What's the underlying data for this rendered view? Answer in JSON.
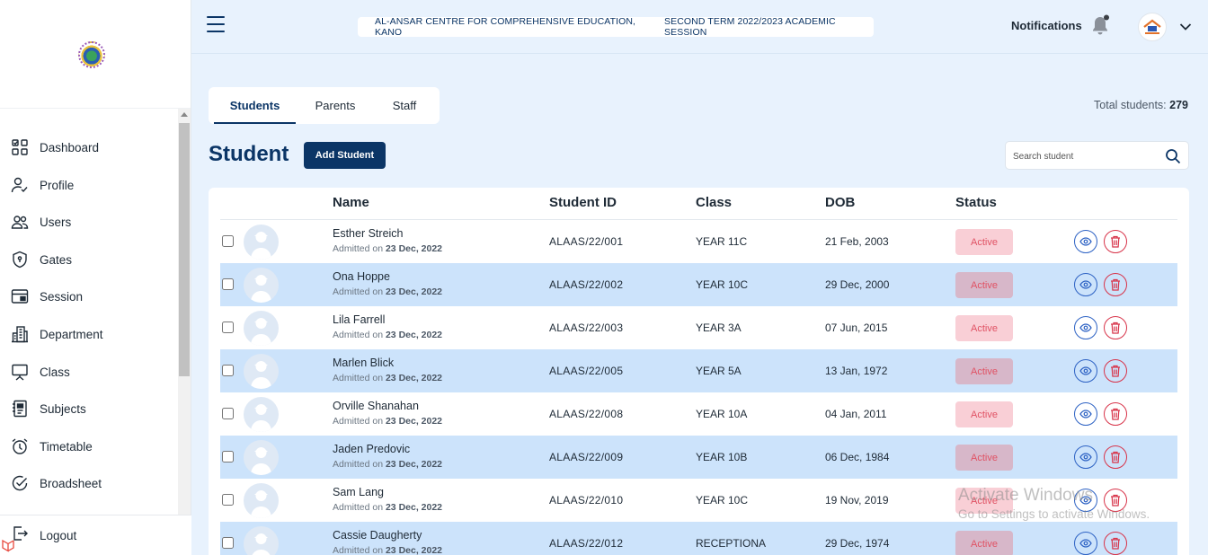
{
  "sidebar": {
    "items": [
      {
        "label": "Dashboard",
        "icon": "dashboard-icon"
      },
      {
        "label": "Profile",
        "icon": "profile-icon"
      },
      {
        "label": "Users",
        "icon": "users-icon"
      },
      {
        "label": "Gates",
        "icon": "shield-icon"
      },
      {
        "label": "Session",
        "icon": "session-icon"
      },
      {
        "label": "Department",
        "icon": "building-icon"
      },
      {
        "label": "Class",
        "icon": "whiteboard-icon"
      },
      {
        "label": "Subjects",
        "icon": "book-icon"
      },
      {
        "label": "Timetable",
        "icon": "alarm-clock-icon"
      },
      {
        "label": "Broadsheet",
        "icon": "badge-check-icon"
      }
    ],
    "logout_label": "Logout"
  },
  "header": {
    "school_name": "AL-ANSAR CENTRE FOR COMPREHENSIVE EDUCATION, KANO",
    "session": "SECOND TERM 2022/2023 ACADEMIC SESSION",
    "notifications_label": "Notifications"
  },
  "tabs": [
    {
      "label": "Students",
      "active": true
    },
    {
      "label": "Parents",
      "active": false
    },
    {
      "label": "Staff",
      "active": false
    }
  ],
  "total": {
    "label": "Total students:",
    "value": "279"
  },
  "page_title": "Student",
  "add_button_label": "Add Student",
  "search": {
    "placeholder": "Search student"
  },
  "table": {
    "columns": [
      "Name",
      "Student ID",
      "Class",
      "DOB",
      "Status"
    ],
    "admitted_prefix": "Admitted on",
    "rows": [
      {
        "name": "Esther Streich",
        "admitted": "23 Dec, 2022",
        "student_id": "ALAAS/22/001",
        "class": "YEAR 11C",
        "dob": "21 Feb, 2003",
        "status": "Active"
      },
      {
        "name": "Ona Hoppe",
        "admitted": "23 Dec, 2022",
        "student_id": "ALAAS/22/002",
        "class": "YEAR 10C",
        "dob": "29 Dec, 2000",
        "status": "Active"
      },
      {
        "name": "Lila Farrell",
        "admitted": "23 Dec, 2022",
        "student_id": "ALAAS/22/003",
        "class": "YEAR 3A",
        "dob": "07 Jun, 2015",
        "status": "Active"
      },
      {
        "name": "Marlen Blick",
        "admitted": "23 Dec, 2022",
        "student_id": "ALAAS/22/005",
        "class": "YEAR 5A",
        "dob": "13 Jan, 1972",
        "status": "Active"
      },
      {
        "name": "Orville Shanahan",
        "admitted": "23 Dec, 2022",
        "student_id": "ALAAS/22/008",
        "class": "YEAR 10A",
        "dob": "04 Jan, 2011",
        "status": "Active"
      },
      {
        "name": "Jaden Predovic",
        "admitted": "23 Dec, 2022",
        "student_id": "ALAAS/22/009",
        "class": "YEAR 10B",
        "dob": "06 Dec, 1984",
        "status": "Active"
      },
      {
        "name": "Sam Lang",
        "admitted": "23 Dec, 2022",
        "student_id": "ALAAS/22/010",
        "class": "YEAR 10C",
        "dob": "19 Nov, 2019",
        "status": "Active"
      },
      {
        "name": "Cassie Daugherty",
        "admitted": "23 Dec, 2022",
        "student_id": "ALAAS/22/012",
        "class": "RECEPTIONA",
        "dob": "29 Dec, 1974",
        "status": "Active"
      }
    ]
  },
  "watermark": {
    "line1": "Activate Windows",
    "line2": "Go to Settings to activate Windows."
  },
  "colors": {
    "primary": "#0b3566",
    "page_bg": "#e8f2fd",
    "row_alt": "#cce3fb",
    "status_text": "#e05264",
    "view_icon": "#2d62c4",
    "delete_icon": "#d8344a"
  }
}
